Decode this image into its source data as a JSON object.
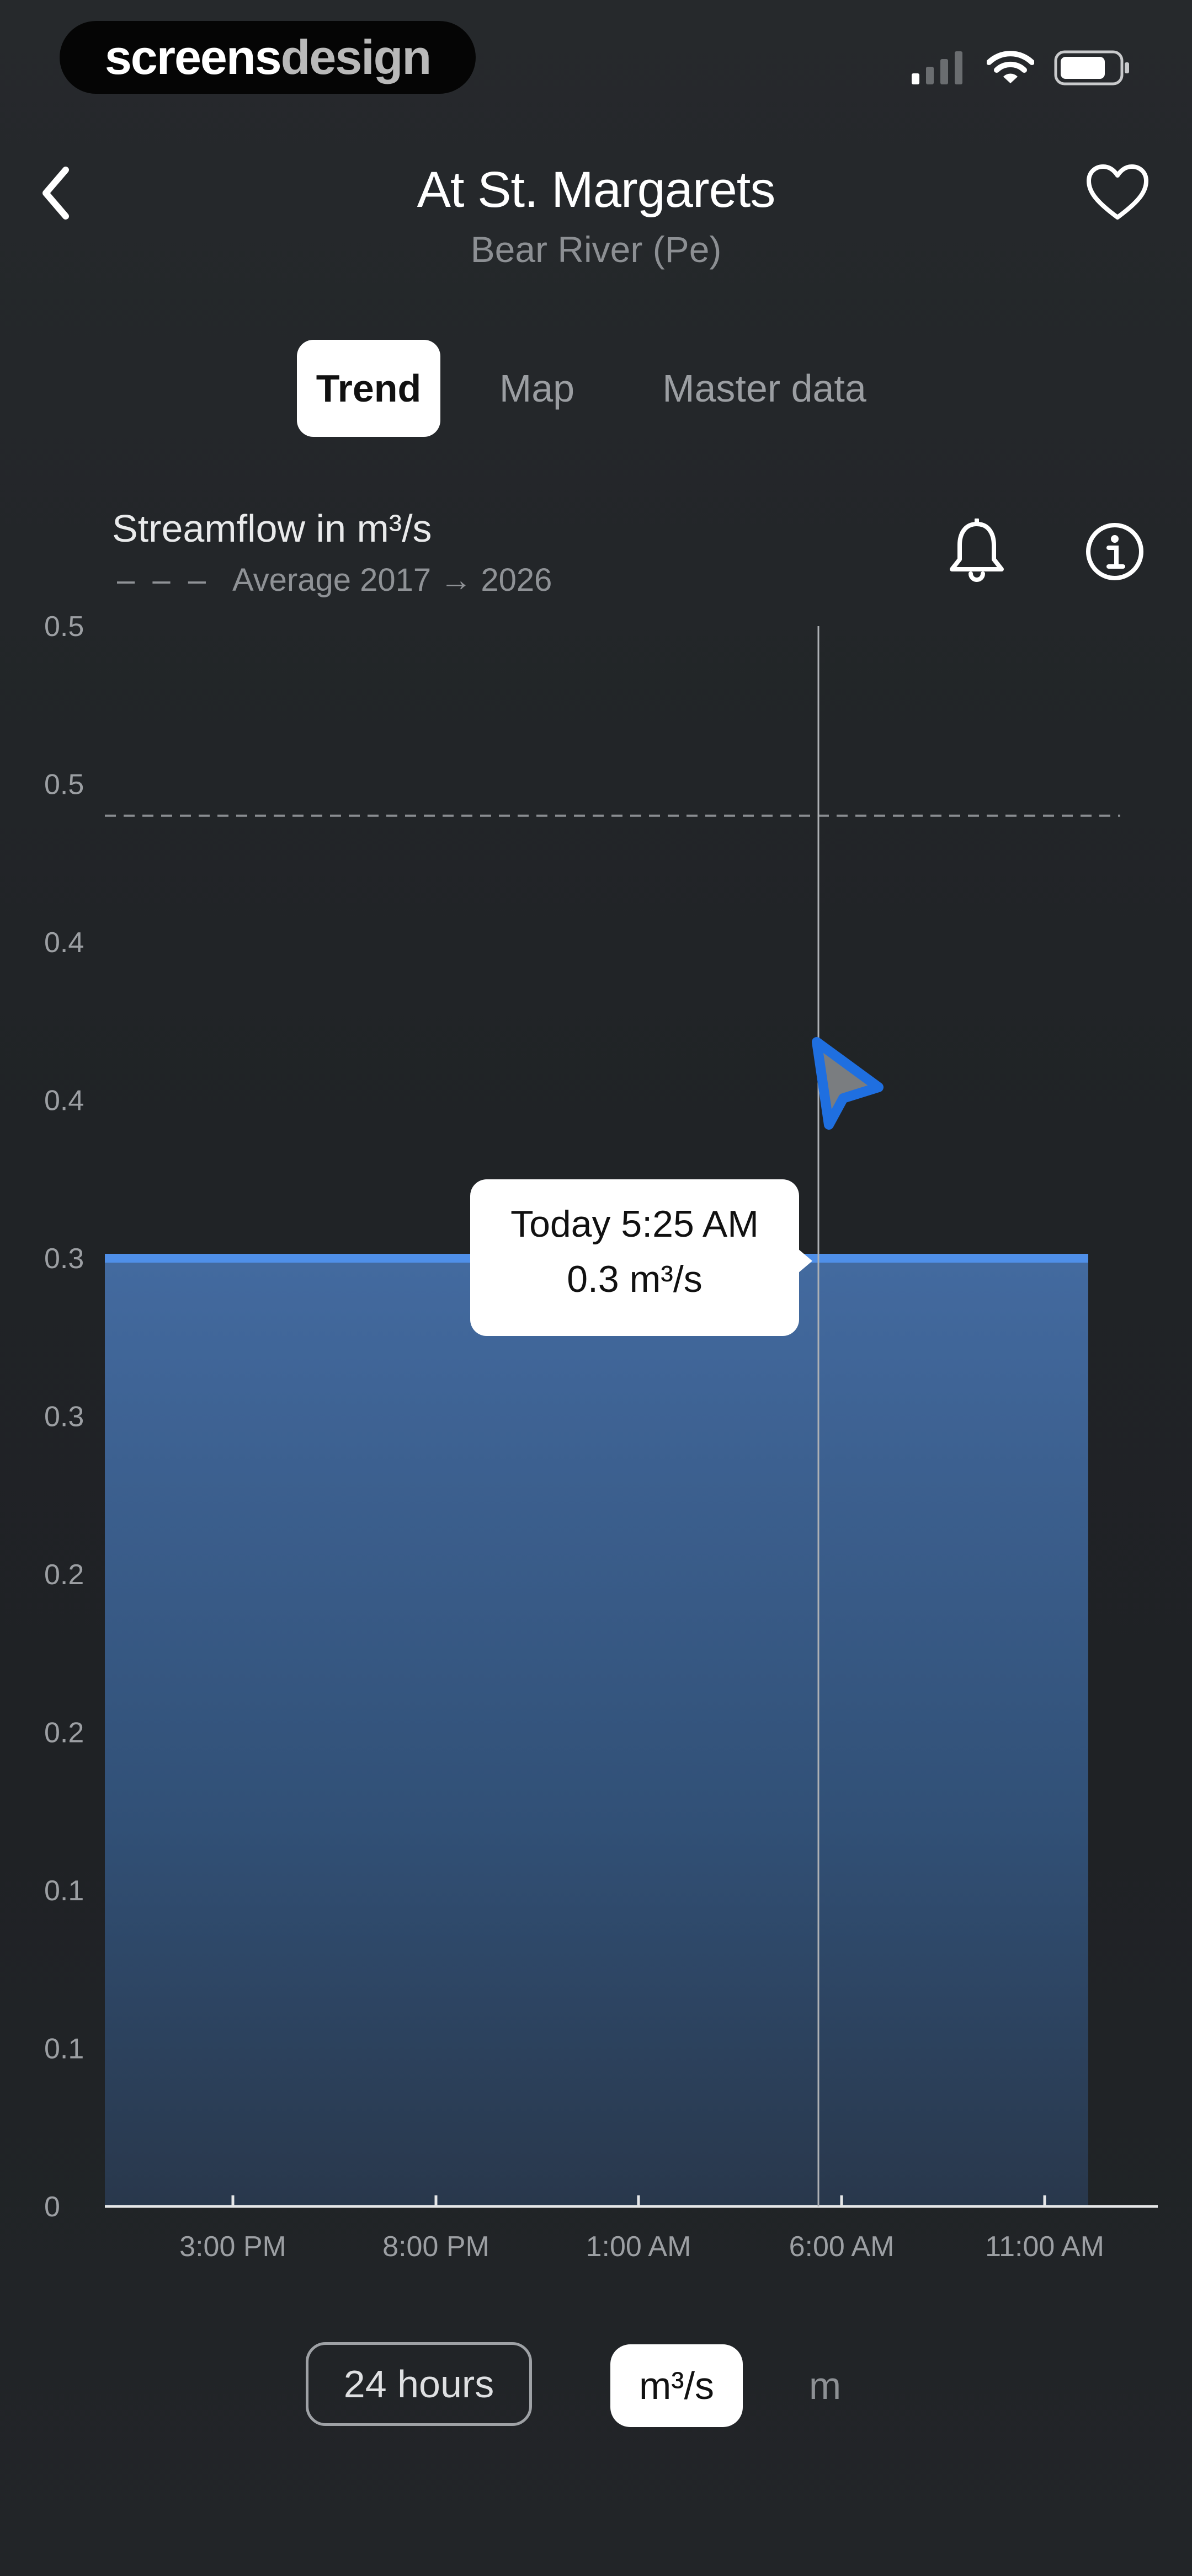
{
  "status_bar": {
    "brand_part1": "screens",
    "brand_part2": "design",
    "icons": [
      "signal-icon",
      "wifi-icon",
      "battery-icon"
    ]
  },
  "header": {
    "title": "At St. Margarets",
    "subtitle": "Bear River (Pe)",
    "back_icon": "chevron-left-icon",
    "favorite_icon": "heart-icon"
  },
  "tabs": [
    {
      "label": "Trend",
      "active": true
    },
    {
      "label": "Map",
      "active": false
    },
    {
      "label": "Master data",
      "active": false
    }
  ],
  "chart_header": {
    "title": "Streamflow in m³/s",
    "legend_dash": "– – –",
    "legend_label": "Average 2017 → 2026",
    "alert_icon": "bell-icon",
    "info_icon": "info-icon"
  },
  "chart_data": {
    "type": "area",
    "title": "Streamflow in m³/s",
    "y_ticks": [
      "0.5",
      "0.5",
      "0.4",
      "0.4",
      "0.3",
      "0.3",
      "0.2",
      "0.2",
      "0.1",
      "0.1",
      "0"
    ],
    "ylim": [
      0,
      0.5
    ],
    "x_tick_labels": [
      "3:00 PM",
      "8:00 PM",
      "1:00 AM",
      "6:00 AM",
      "11:00 AM"
    ],
    "series": [
      {
        "values": [
          0.3,
          0.3,
          0.3,
          0.3,
          0.3,
          0.3
        ],
        "color": "#4f8fe8"
      }
    ],
    "average_line": 0.44,
    "grid": false,
    "cursor_time": "Today 5:25 AM",
    "cursor_value": "0.3 m³/s"
  },
  "tooltip": {
    "time": "Today 5:25 AM",
    "value": "0.3 m³/s"
  },
  "controls": {
    "range_label": "24 hours",
    "unit_active": "m³/s",
    "unit_inactive": "m"
  },
  "colors": {
    "accent": "#4f8fe8",
    "background": "#232629",
    "tooltip_bg": "#ffffff"
  }
}
